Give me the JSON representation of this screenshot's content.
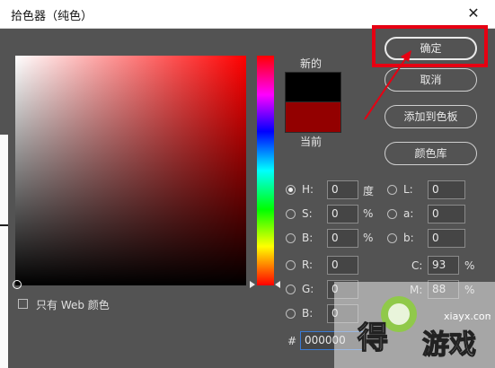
{
  "window": {
    "title": "拾色器（纯色）",
    "close_glyph": "✕"
  },
  "labels": {
    "new": "新的",
    "current": "当前"
  },
  "swatches": {
    "new_color": "#000000",
    "current_color": "#930000"
  },
  "buttons": {
    "ok": "确定",
    "cancel": "取消",
    "add_to_swatches": "添加到色板",
    "color_libraries": "颜色库"
  },
  "fields": {
    "H": {
      "label": "H:",
      "value": "0",
      "unit": "度",
      "checked": true
    },
    "S": {
      "label": "S:",
      "value": "0",
      "unit": "%"
    },
    "B": {
      "label": "B:",
      "value": "0",
      "unit": "%"
    },
    "R": {
      "label": "R:",
      "value": "0"
    },
    "G": {
      "label": "G:",
      "value": "0"
    },
    "Bl": {
      "label": "B:",
      "value": "0"
    },
    "L": {
      "label": "L:",
      "value": "0"
    },
    "a": {
      "label": "a:",
      "value": "0"
    },
    "b": {
      "label": "b:",
      "value": "0"
    },
    "C": {
      "label": "C:",
      "value": "93",
      "unit": "%"
    },
    "M": {
      "label": "M:",
      "value": "88",
      "unit": "%"
    },
    "hex": {
      "label": "#",
      "value": "000000"
    }
  },
  "web_only": {
    "label": "只有 Web 颜色",
    "checked": false
  },
  "watermark": {
    "text": "游戏",
    "sub": "xiayx.com"
  },
  "colors": {
    "highlight": "#e60012",
    "dialog_bg": "#535353"
  }
}
